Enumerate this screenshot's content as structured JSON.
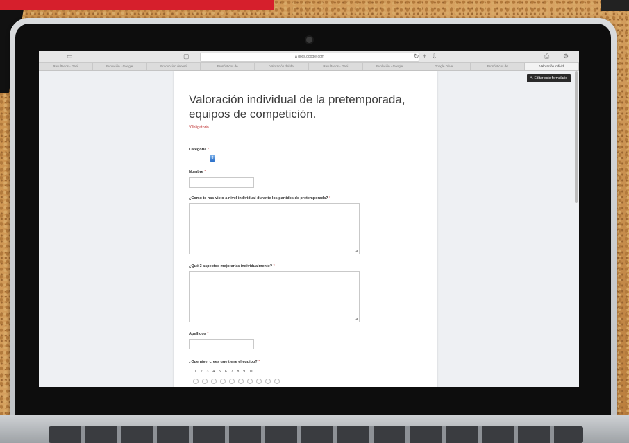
{
  "browser": {
    "url": "docs.google.com",
    "tabs": [
      "Resultados - Gabi",
      "Evolución - Google",
      "Producción deporti",
      "Pronósticos de",
      "Valoración del de",
      "Resultados - Gabi",
      "Evolución - Google",
      "Google Drive",
      "Pronósticos de",
      "Valoración individ"
    ],
    "active_tab_index": 9
  },
  "form": {
    "edit_label": "Editar este formulario",
    "title": "Valoración individual de la pretemporada, equipos de competición.",
    "required_note": "*Obligatorio",
    "questions": {
      "categoria": "Categoría",
      "nombre": "Nombre",
      "como_visto": "¿Como te has visto a nivel individual durante los partidos de pretemporada?",
      "aspectos": "¿Qué 3 aspectos mejorarías individualmente?",
      "apellidos": "Apellidos",
      "nivel": "¿Que nivel crees que tiene el equipo?"
    },
    "required_mark": "*",
    "scale": [
      "1",
      "2",
      "3",
      "4",
      "5",
      "6",
      "7",
      "8",
      "9",
      "10"
    ]
  },
  "icons": [
    "sidebar-icon",
    "share-icon",
    "reload-icon",
    "download-icon",
    "gear-icon",
    "pencil-icon",
    "dropdown-arrow-icon",
    "resize-grip-icon"
  ]
}
